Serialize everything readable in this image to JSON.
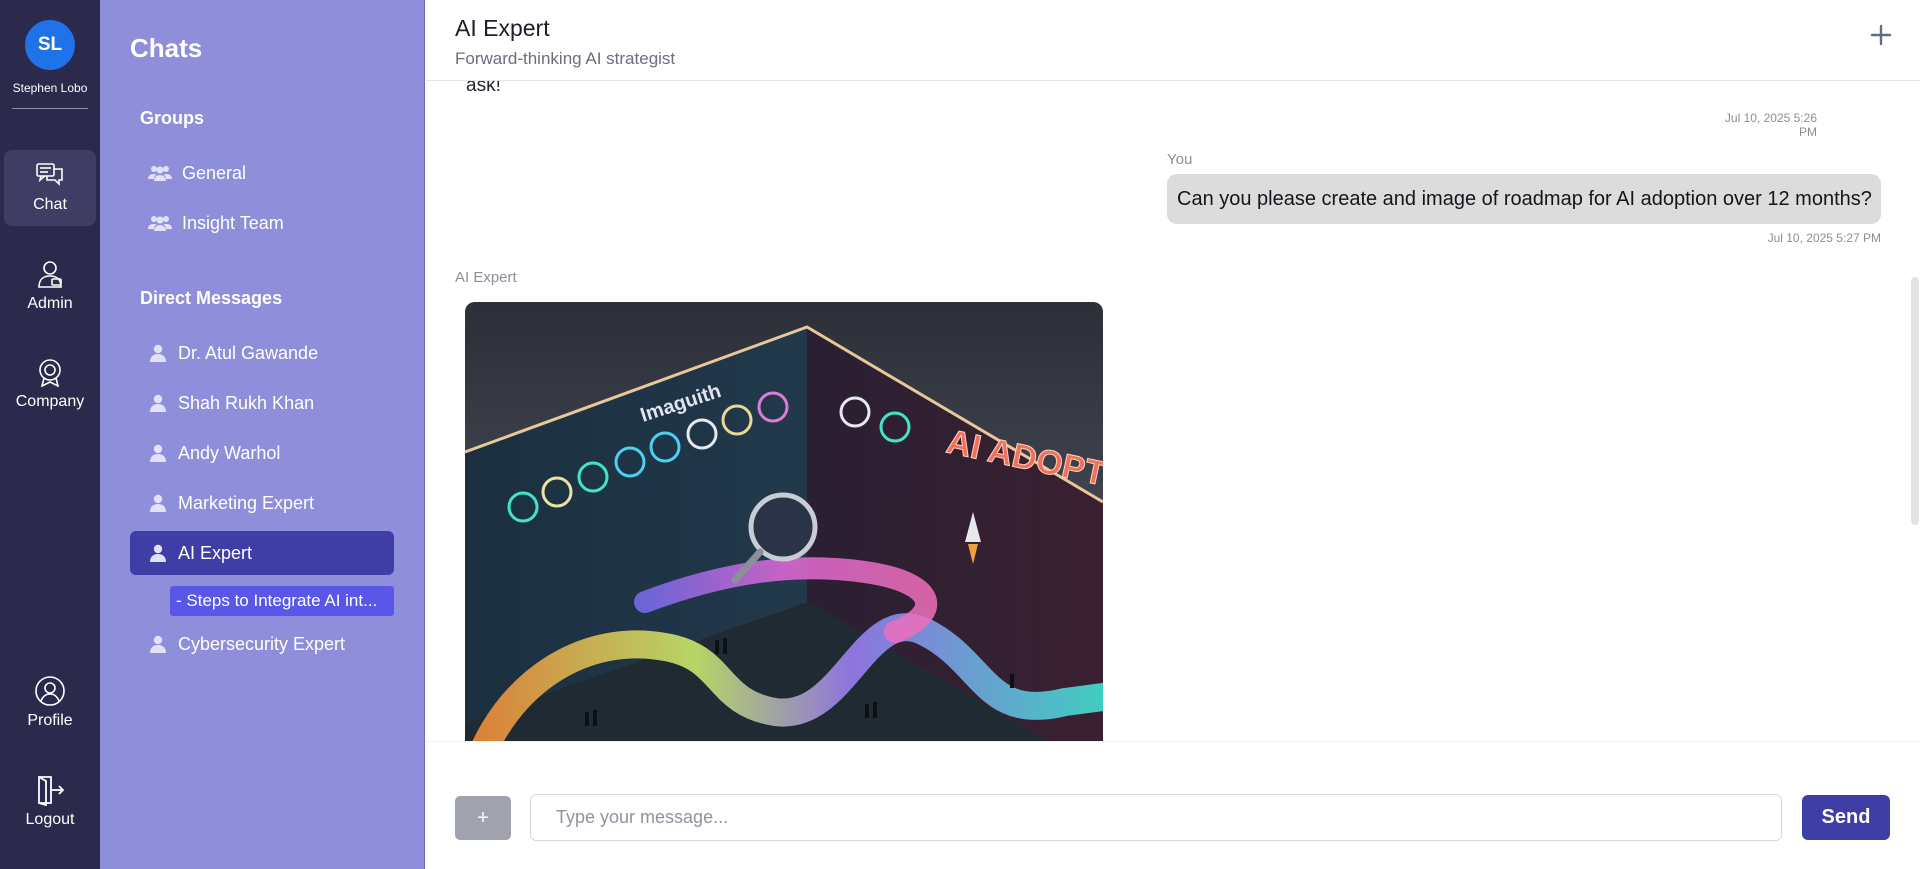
{
  "user": {
    "initials": "SL",
    "name": "Stephen Lobo"
  },
  "rail": {
    "chat": "Chat",
    "admin": "Admin",
    "company": "Company",
    "profile": "Profile",
    "logout": "Logout"
  },
  "sidebar": {
    "title": "Chats",
    "groups_heading": "Groups",
    "groups": [
      "General",
      "Insight Team"
    ],
    "dm_heading": "Direct Messages",
    "direct_messages": [
      "Dr. Atul Gawande",
      "Shah Rukh Khan",
      "Andy Warhol",
      "Marketing Expert",
      "AI Expert",
      "Cybersecurity Expert"
    ],
    "active_thread": "- Steps to Integrate AI int..."
  },
  "header": {
    "title": "AI Expert",
    "subtitle": "Forward-thinking AI strategist"
  },
  "messages": {
    "previous_tail": "ask!",
    "previous_timestamp": "Jul 10, 2025 5:26 PM",
    "user_label": "You",
    "user_text": "Can you please create and image of roadmap for AI adoption over 12 months?",
    "user_timestamp": "Jul 10, 2025 5:27 PM",
    "ai_label": "AI Expert",
    "image_text_top": "Imaguith",
    "image_text_right": "AI ADOPTIO"
  },
  "composer": {
    "attach_label": "+",
    "placeholder": "Type your message...",
    "send_label": "Send"
  },
  "colors": {
    "rail_bg": "#2b2a4c",
    "sidebar_bg": "#8f8edb",
    "active_item": "#3f3ea6",
    "sub_item": "#5a57e8",
    "avatar": "#1e73e8"
  },
  "icons": {
    "chat": "chat-bubbles-icon",
    "admin": "admin-user-icon",
    "company": "company-badge-icon",
    "profile": "profile-icon",
    "logout": "logout-icon",
    "group": "users-group-icon",
    "dm": "person-icon",
    "new_chat": "plus-icon"
  }
}
